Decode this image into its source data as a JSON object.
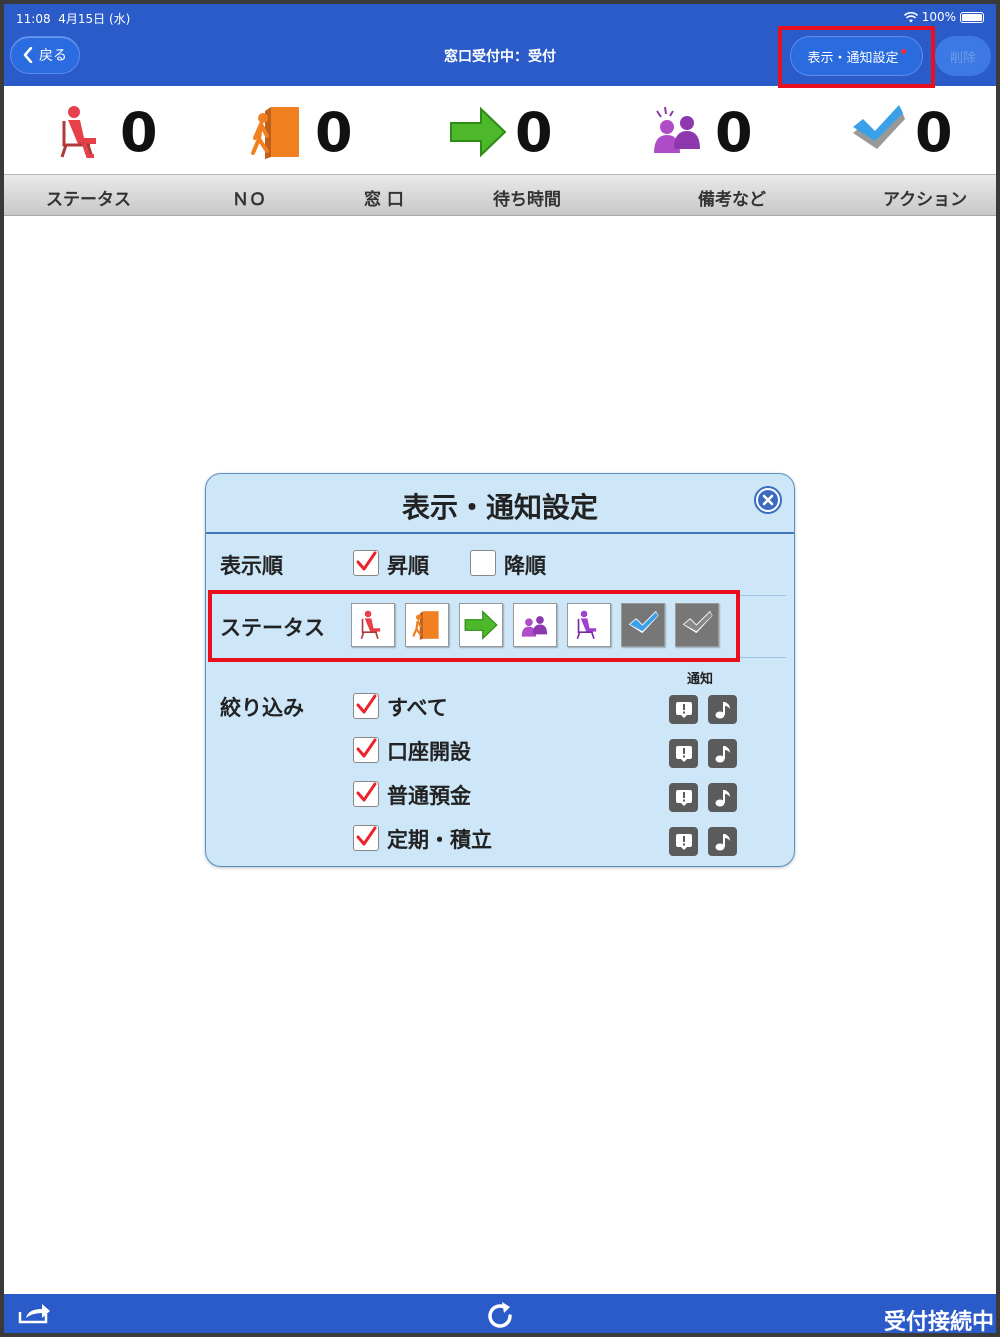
{
  "status_bar": {
    "time": "11:08",
    "date": "4月15日 (水)",
    "battery": "100%"
  },
  "nav": {
    "back_label": "戻る",
    "title": "窓口受付中：受付",
    "settings_label": "表示・通知設定",
    "delete_label": "削除"
  },
  "counters": [
    {
      "icon": "seated-person-icon",
      "value": "0"
    },
    {
      "icon": "exit-door-icon",
      "value": "0"
    },
    {
      "icon": "green-arrow-icon",
      "value": "0"
    },
    {
      "icon": "group-people-icon",
      "value": "0"
    },
    {
      "icon": "checkmark-icon",
      "value": "0"
    }
  ],
  "columns": [
    "ステータス",
    "ＮＯ",
    "窓 口",
    "待ち時間",
    "備考など",
    "アクション"
  ],
  "modal": {
    "title": "表示・通知設定",
    "sort": {
      "label": "表示順",
      "asc_label": "昇順",
      "asc_checked": true,
      "desc_label": "降順",
      "desc_checked": false
    },
    "status": {
      "label": "ステータス",
      "icons": [
        "seated-person-icon",
        "exit-door-icon",
        "green-arrow-icon",
        "group-people-icon",
        "purple-seated-person-icon",
        "blue-check-icon",
        "gray-check-icon"
      ]
    },
    "filter": {
      "label": "絞り込み",
      "notice_header": "通知",
      "items": [
        {
          "label": "すべて",
          "checked": true
        },
        {
          "label": "口座開設",
          "checked": true
        },
        {
          "label": "普通預金",
          "checked": true
        },
        {
          "label": "定期・積立",
          "checked": true
        }
      ]
    }
  },
  "bottom": {
    "connection_status": "受付接続中"
  },
  "colors": {
    "nav_blue": "#2a5bc8",
    "modal_bg": "#cde6f8",
    "highlight_red": "#e8101c",
    "check_red": "#e8242c"
  }
}
